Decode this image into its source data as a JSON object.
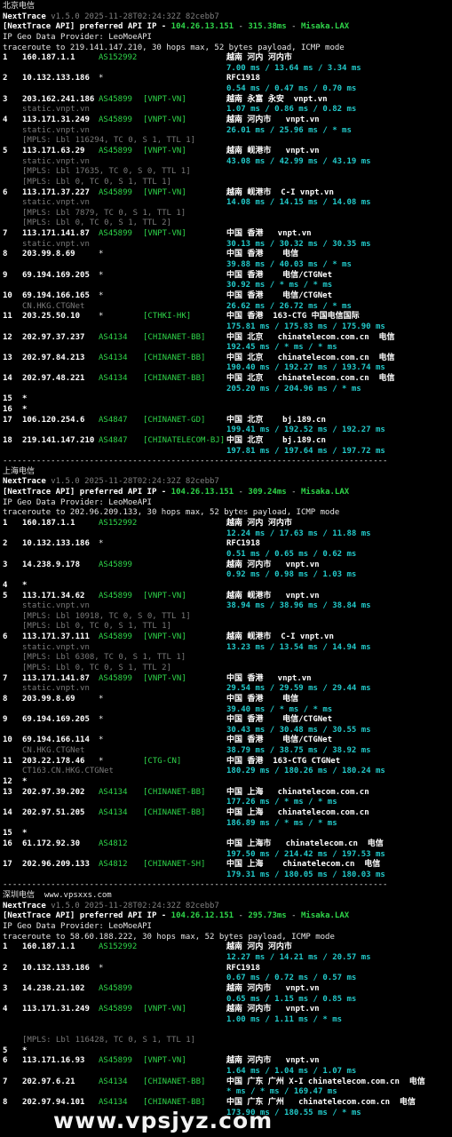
{
  "sections": [
    {
      "title": "北京电信",
      "header": {
        "app": "NextTrace",
        "version": "v1.5.0 2025-11-28T02:24:32Z 82cebb7",
        "api_prefix": "[NextTrace API] preferred API IP - ",
        "api_ip": "104.26.13.151",
        "api_latency": "315.38ms",
        "api_node": "Misaka.LAX",
        "geo_provider": "IP Geo Data Provider: LeoMoeAPI",
        "trace_info": "traceroute to 219.141.147.210, 30 hops max, 52 bytes payload, ICMP mode"
      },
      "hops": [
        {
          "hop": "1",
          "ip": "160.187.1.1",
          "asn": "AS152992",
          "tag": "",
          "geo": "越南 河内 河内市",
          "rtt": "7.00 ms / 13.64 ms / 3.34 ms"
        },
        {
          "hop": "2",
          "ip": "10.132.133.186",
          "asn": "*",
          "tag": "",
          "geo": "RFC1918",
          "rtt": "0.54 ms / 0.47 ms / 0.70 ms"
        },
        {
          "hop": "3",
          "ip": "203.162.241.186",
          "asn": "AS45899",
          "tag": "[VNPT-VN]",
          "geo": "越南 永富 永安  vnpt.vn",
          "host": "static.vnpt.vn",
          "rtt": "1.07 ms / 0.86 ms / 0.82 ms"
        },
        {
          "hop": "4",
          "ip": "113.171.31.249",
          "asn": "AS45899",
          "tag": "[VNPT-VN]",
          "geo": "越南 河内市   vnpt.vn",
          "host": "static.vnpt.vn",
          "rtt": "26.01 ms / 25.96 ms / * ms",
          "mpls": [
            "[MPLS: Lbl 116294, TC 0, S 1, TTL 1]"
          ]
        },
        {
          "hop": "5",
          "ip": "113.171.63.29",
          "asn": "AS45899",
          "tag": "[VNPT-VN]",
          "geo": "越南 岘港市   vnpt.vn",
          "host": "static.vnpt.vn",
          "rtt": "43.08 ms / 42.99 ms / 43.19 ms",
          "mpls": [
            "[MPLS: Lbl 17635, TC 0, S 0, TTL 1]",
            "[MPLS: Lbl 0, TC 0, S 1, TTL 1]"
          ]
        },
        {
          "hop": "6",
          "ip": "113.171.37.227",
          "asn": "AS45899",
          "tag": "[VNPT-VN]",
          "geo": "越南 岘港市  C-I vnpt.vn",
          "host": "static.vnpt.vn",
          "rtt": "14.08 ms / 14.15 ms / 14.08 ms",
          "mpls": [
            "[MPLS: Lbl 7879, TC 0, S 1, TTL 1]",
            "[MPLS: Lbl 0, TC 0, S 1, TTL 2]"
          ]
        },
        {
          "hop": "7",
          "ip": "113.171.141.87",
          "asn": "AS45899",
          "tag": "[VNPT-VN]",
          "geo": "中国 香港   vnpt.vn",
          "host": "static.vnpt.vn",
          "rtt": "30.13 ms / 30.32 ms / 30.35 ms"
        },
        {
          "hop": "8",
          "ip": "203.99.8.69",
          "asn": "*",
          "tag": "",
          "geo": "中国 香港    电信",
          "rtt": "39.88 ms / 40.03 ms / * ms"
        },
        {
          "hop": "9",
          "ip": "69.194.169.205",
          "asn": "*",
          "tag": "",
          "geo": "中国 香港    电信/CTGNet",
          "rtt": "30.92 ms / * ms / * ms"
        },
        {
          "hop": "10",
          "ip": "69.194.166.165",
          "asn": "*",
          "tag": "",
          "geo": "中国 香港    电信/CTGNet",
          "host": "CN.HKG.CTGNet",
          "rtt": "26.62 ms / 26.72 ms / * ms"
        },
        {
          "hop": "11",
          "ip": "203.25.50.10",
          "asn": "*",
          "tag": "[CTHKI-HK]",
          "geo": "中国 香港  163-CTG 中国电信国际",
          "rtt": "175.81 ms / 175.83 ms / 175.90 ms"
        },
        {
          "hop": "12",
          "ip": "202.97.37.237",
          "asn": "AS4134",
          "tag": "[CHINANET-BB]",
          "geo": "中国 北京   chinatelecom.com.cn  电信",
          "rtt": "192.45 ms / * ms / * ms"
        },
        {
          "hop": "13",
          "ip": "202.97.84.213",
          "asn": "AS4134",
          "tag": "[CHINANET-BB]",
          "geo": "中国 北京   chinatelecom.com.cn  电信",
          "rtt": "190.40 ms / 192.27 ms / 193.74 ms"
        },
        {
          "hop": "14",
          "ip": "202.97.48.221",
          "asn": "AS4134",
          "tag": "[CHINANET-BB]",
          "geo": "中国 北京   chinatelecom.com.cn  电信",
          "rtt": "205.20 ms / 204.96 ms / * ms"
        },
        {
          "hop": "15",
          "ip": "*"
        },
        {
          "hop": "16",
          "ip": "*"
        },
        {
          "hop": "17",
          "ip": "106.120.254.6",
          "asn": "AS4847",
          "tag": "[CHINANET-GD]",
          "geo": "中国 北京    bj.189.cn",
          "rtt": "199.41 ms / 192.52 ms / 192.27 ms"
        },
        {
          "hop": "18",
          "ip": "219.141.147.210",
          "asn": "AS4847",
          "tag": "[CHINATELECOM-BJ]",
          "geo": "中国 北京    bj.189.cn",
          "rtt": "197.81 ms / 197.64 ms / 197.72 ms"
        }
      ]
    },
    {
      "title": "上海电信",
      "header": {
        "app": "NextTrace",
        "version": "v1.5.0 2025-11-28T02:24:32Z 82cebb7",
        "api_prefix": "[NextTrace API] preferred API IP - ",
        "api_ip": "104.26.13.151",
        "api_latency": "309.24ms",
        "api_node": "Misaka.LAX",
        "geo_provider": "IP Geo Data Provider: LeoMoeAPI",
        "trace_info": "traceroute to 202.96.209.133, 30 hops max, 52 bytes payload, ICMP mode"
      },
      "hops": [
        {
          "hop": "1",
          "ip": "160.187.1.1",
          "asn": "AS152992",
          "tag": "",
          "geo": "越南 河内 河内市",
          "rtt": "12.24 ms / 17.63 ms / 11.88 ms"
        },
        {
          "hop": "2",
          "ip": "10.132.133.186",
          "asn": "*",
          "tag": "",
          "geo": "RFC1918",
          "rtt": "0.51 ms / 0.65 ms / 0.62 ms"
        },
        {
          "hop": "3",
          "ip": "14.238.9.178",
          "asn": "AS45899",
          "tag": "",
          "geo": "越南 河内市   vnpt.vn",
          "rtt": "0.92 ms / 0.98 ms / 1.03 ms"
        },
        {
          "hop": "4",
          "ip": "*"
        },
        {
          "hop": "5",
          "ip": "113.171.34.62",
          "asn": "AS45899",
          "tag": "[VNPT-VN]",
          "geo": "越南 岘港市   vnpt.vn",
          "host": "static.vnpt.vn",
          "rtt": "38.94 ms / 38.96 ms / 38.84 ms",
          "mpls": [
            "[MPLS: Lbl 10918, TC 0, S 0, TTL 1]",
            "[MPLS: Lbl 0, TC 0, S 1, TTL 1]"
          ]
        },
        {
          "hop": "6",
          "ip": "113.171.37.111",
          "asn": "AS45899",
          "tag": "[VNPT-VN]",
          "geo": "越南 岘港市  C-I vnpt.vn",
          "host": "static.vnpt.vn",
          "rtt": "13.23 ms / 13.54 ms / 14.94 ms",
          "mpls": [
            "[MPLS: Lbl 6308, TC 0, S 1, TTL 1]",
            "[MPLS: Lbl 0, TC 0, S 1, TTL 2]"
          ]
        },
        {
          "hop": "7",
          "ip": "113.171.141.87",
          "asn": "AS45899",
          "tag": "[VNPT-VN]",
          "geo": "中国 香港   vnpt.vn",
          "host": "static.vnpt.vn",
          "rtt": "29.54 ms / 29.59 ms / 29.44 ms"
        },
        {
          "hop": "8",
          "ip": "203.99.8.69",
          "asn": "*",
          "tag": "",
          "geo": "中国 香港    电信",
          "rtt": "39.40 ms / * ms / * ms"
        },
        {
          "hop": "9",
          "ip": "69.194.169.205",
          "asn": "*",
          "tag": "",
          "geo": "中国 香港    电信/CTGNet",
          "rtt": "30.43 ms / 30.48 ms / 30.55 ms"
        },
        {
          "hop": "10",
          "ip": "69.194.166.114",
          "asn": "*",
          "tag": "",
          "geo": "中国 香港    电信/CTGNet",
          "host": "CN.HKG.CTGNet",
          "rtt": "38.79 ms / 38.75 ms / 38.92 ms"
        },
        {
          "hop": "11",
          "ip": "203.22.178.46",
          "asn": "*",
          "tag": "[CTG-CN]",
          "geo": "中国 香港  163-CTG CTGNet",
          "host": "CT163.CN.HKG.CTGNet",
          "rtt": "180.29 ms / 180.26 ms / 180.24 ms"
        },
        {
          "hop": "12",
          "ip": "*"
        },
        {
          "hop": "13",
          "ip": "202.97.39.202",
          "asn": "AS4134",
          "tag": "[CHINANET-BB]",
          "geo": "中国 上海   chinatelecom.com.cn",
          "rtt": "177.26 ms / * ms / * ms"
        },
        {
          "hop": "14",
          "ip": "202.97.51.205",
          "asn": "AS4134",
          "tag": "[CHINANET-BB]",
          "geo": "中国 上海   chinatelecom.com.cn",
          "rtt": "186.89 ms / * ms / * ms"
        },
        {
          "hop": "15",
          "ip": "*"
        },
        {
          "hop": "16",
          "ip": "61.172.92.30",
          "asn": "AS4812",
          "tag": "",
          "geo": "中国 上海市   chinatelecom.cn  电信",
          "rtt": "197.50 ms / 214.42 ms / 197.53 ms"
        },
        {
          "hop": "17",
          "ip": "202.96.209.133",
          "asn": "AS4812",
          "tag": "[CHINANET-SH]",
          "geo": "中国 上海    chinatelecom.cn  电信",
          "rtt": "179.31 ms / 180.05 ms / 180.03 ms"
        }
      ]
    },
    {
      "title": "深圳电信",
      "title_extra": "www.vpsxxs.com",
      "header": {
        "app": "NextTrace",
        "version": "v1.5.0 2025-11-28T02:24:32Z 82cebb7",
        "api_prefix": "[NextTrace API] preferred API IP - ",
        "api_ip": "104.26.12.151",
        "api_latency": "295.73ms",
        "api_node": "Misaka.LAX",
        "geo_provider": "IP Geo Data Provider: LeoMoeAPI",
        "trace_info": "traceroute to 58.60.188.222, 30 hops max, 52 bytes payload, ICMP mode"
      },
      "hops": [
        {
          "hop": "1",
          "ip": "160.187.1.1",
          "asn": "AS152992",
          "tag": "",
          "geo": "越南 河内 河内市",
          "rtt": "12.27 ms / 14.21 ms / 20.57 ms"
        },
        {
          "hop": "2",
          "ip": "10.132.133.186",
          "asn": "*",
          "tag": "",
          "geo": "RFC1918",
          "rtt": "0.67 ms / 0.72 ms / 0.57 ms"
        },
        {
          "hop": "3",
          "ip": "14.238.21.102",
          "asn": "AS45899",
          "tag": "",
          "geo": "越南 河内市   vnpt.vn",
          "rtt": "0.65 ms / 1.15 ms / 0.85 ms"
        },
        {
          "hop": "4",
          "ip": "113.171.31.249",
          "asn": "AS45899",
          "tag": "[VNPT-VN]",
          "geo": "越南 河内市   vnpt.vn",
          "rtt": "1.00 ms / 1.11 ms / * ms",
          "mpls_gap": true,
          "mpls": [
            "[MPLS: Lbl 116428, TC 0, S 1, TTL 1]"
          ]
        },
        {
          "hop": "5",
          "ip": "*"
        },
        {
          "hop": "6",
          "ip": "113.171.16.93",
          "asn": "AS45899",
          "tag": "[VNPT-VN]",
          "geo": "越南 河内市   vnpt.vn",
          "rtt": "1.64 ms / 1.04 ms / 1.07 ms"
        },
        {
          "hop": "7",
          "ip": "202.97.6.21",
          "asn": "AS4134",
          "tag": "[CHINANET-BB]",
          "geo": "中国 广东 广州 X-I chinatelecom.com.cn  电信",
          "rtt": "* ms / * ms / 169.47 ms"
        },
        {
          "hop": "8",
          "ip": "202.97.94.101",
          "asn": "AS4134",
          "tag": "[CHINANET-BB]",
          "geo": "中国 广东 广州   chinatelecom.com.cn  电信",
          "rtt": "173.90 ms / 180.55 ms / * ms"
        }
      ]
    }
  ],
  "separator": "--------------------------------------------------------------------------------",
  "watermark": "www.vpsjyz.com",
  "colors": {
    "background": "#000000",
    "green": "#2fd64a",
    "yellow": "#e8d23a",
    "cyan": "#22c9c9",
    "dim": "#7a7a7a"
  }
}
